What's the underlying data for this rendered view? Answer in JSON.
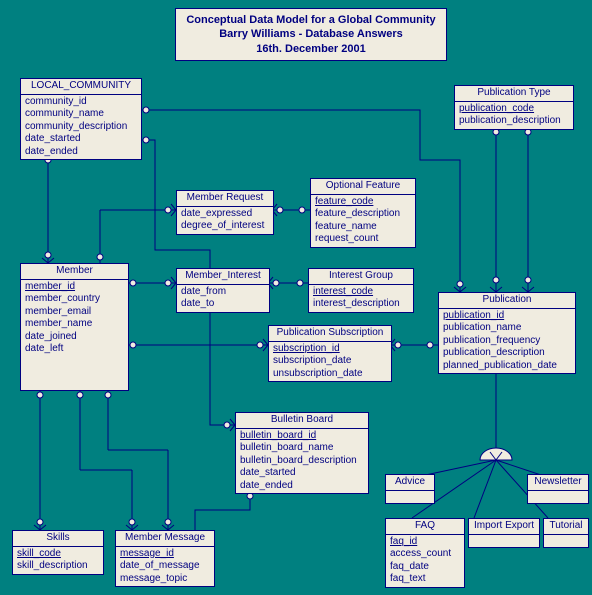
{
  "title": {
    "line1": "Conceptual Data Model for a Global Community",
    "line2": "Barry Williams - Database Answers",
    "line3": "16th. December 2001"
  },
  "entities": {
    "local_community": {
      "name": "LOCAL_COMMUNITY",
      "attrs": [
        "community_id",
        "community_name",
        "community_description",
        "date_started",
        "date_ended"
      ]
    },
    "publication_type": {
      "name": "Publication Type",
      "pk": "publication_code",
      "attrs": [
        "publication_description"
      ]
    },
    "member_request": {
      "name": "Member Request",
      "attrs": [
        "date_expressed",
        "degree_of_interest"
      ]
    },
    "optional_feature": {
      "name": "Optional Feature",
      "pk": "feature_code",
      "attrs": [
        "feature_description",
        "feature_name",
        "request_count"
      ]
    },
    "member": {
      "name": "Member",
      "pk": "member_id",
      "attrs": [
        "member_country",
        "member_email",
        "member_name",
        "date_joined",
        "date_left"
      ]
    },
    "member_interest": {
      "name": "Member_Interest",
      "attrs": [
        "date_from",
        "date_to"
      ]
    },
    "interest_group": {
      "name": "Interest Group",
      "pk": "interest_code",
      "attrs": [
        "interest_description"
      ]
    },
    "publication": {
      "name": "Publication",
      "pk": "publication_id",
      "attrs": [
        "publication_name",
        "publication_frequency",
        "publication_description",
        "planned_publication_date"
      ]
    },
    "publication_subscription": {
      "name": "Publication Subscription",
      "pk": "subscription_id",
      "attrs": [
        "subscription_date",
        "unsubscription_date"
      ]
    },
    "bulletin_board": {
      "name": "Bulletin Board",
      "pk": "bulletin_board_id",
      "attrs": [
        "bulletin_board_name",
        "bulletin_board_description",
        "date_started",
        "date_ended"
      ]
    },
    "advice": {
      "name": "Advice"
    },
    "newsletter": {
      "name": "Newsletter"
    },
    "faq": {
      "name": "FAQ",
      "pk": "faq_id",
      "attrs": [
        "access_count",
        "faq_date",
        "faq_text"
      ]
    },
    "import_export": {
      "name": "Import Export"
    },
    "tutorial": {
      "name": "Tutorial"
    },
    "skills": {
      "name": "Skills",
      "pk": "skill_code",
      "attrs": [
        "skill_description"
      ]
    },
    "member_message": {
      "name": "Member Message",
      "pk": "message_id",
      "attrs": [
        "date_of_message",
        "message_topic"
      ]
    }
  }
}
